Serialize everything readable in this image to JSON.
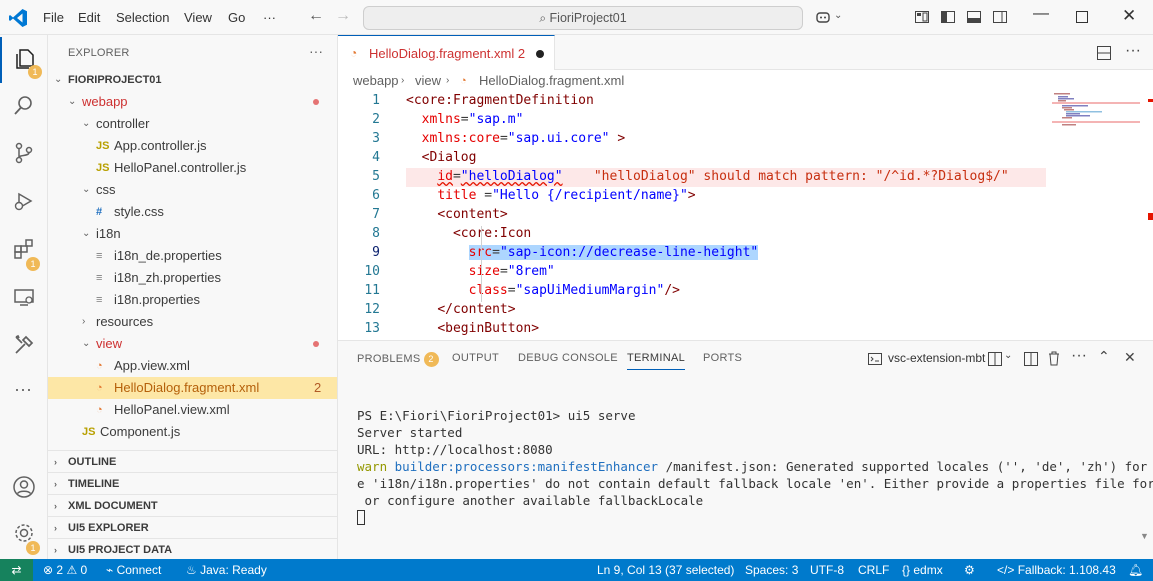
{
  "titlebar": {
    "menu": [
      "File",
      "Edit",
      "Selection",
      "View",
      "Go"
    ],
    "more": "···",
    "search": "FioriProject01"
  },
  "sidebar": {
    "header": "EXPLORER",
    "project": "FIORIPROJECT01",
    "tree": [
      {
        "label": "webapp",
        "kind": "folder-open",
        "depth": 1,
        "status": "dot"
      },
      {
        "label": "controller",
        "kind": "folder-open",
        "depth": 2
      },
      {
        "label": "App.controller.js",
        "kind": "js",
        "depth": 3
      },
      {
        "label": "HelloPanel.controller.js",
        "kind": "js",
        "depth": 3
      },
      {
        "label": "css",
        "kind": "folder-open",
        "depth": 2
      },
      {
        "label": "style.css",
        "kind": "css",
        "depth": 3
      },
      {
        "label": "i18n",
        "kind": "folder-open",
        "depth": 2
      },
      {
        "label": "i18n_de.properties",
        "kind": "props",
        "depth": 3
      },
      {
        "label": "i18n_zh.properties",
        "kind": "props",
        "depth": 3
      },
      {
        "label": "i18n.properties",
        "kind": "props",
        "depth": 3
      },
      {
        "label": "resources",
        "kind": "folder-closed",
        "depth": 2
      },
      {
        "label": "view",
        "kind": "folder-open",
        "depth": 2,
        "status": "dot"
      },
      {
        "label": "App.view.xml",
        "kind": "xml",
        "depth": 3
      },
      {
        "label": "HelloDialog.fragment.xml",
        "kind": "xml",
        "depth": 3,
        "selected": true,
        "count": "2"
      },
      {
        "label": "HelloPanel.view.xml",
        "kind": "xml",
        "depth": 3
      },
      {
        "label": "Component.js",
        "kind": "js",
        "depth": 2
      }
    ],
    "sections": [
      "OUTLINE",
      "TIMELINE",
      "XML DOCUMENT",
      "UI5 EXPLORER",
      "UI5 PROJECT DATA"
    ]
  },
  "editor": {
    "tab_label": "HelloDialog.fragment.xml",
    "tab_count": "2",
    "breadcrumb": [
      "webapp",
      "view",
      "HelloDialog.fragment.xml"
    ],
    "line_numbers": [
      "1",
      "2",
      "3",
      "4",
      "5",
      "6",
      "7",
      "8",
      "9",
      "10",
      "11",
      "12",
      "13"
    ],
    "hint": "\"helloDialog\" should match pattern: \"/^id.*?Dialog$/\""
  },
  "panel": {
    "tabs": [
      "PROBLEMS",
      "OUTPUT",
      "DEBUG CONSOLE",
      "TERMINAL",
      "PORTS"
    ],
    "problems_count": "2",
    "terminal_name": "vsc-extension-mbt",
    "terminal_lines": {
      "prompt": "PS E:\\Fiori\\FioriProject01>",
      "command": "ui5 serve",
      "line2": "Server started",
      "line3": "URL: http://localhost:8080",
      "warn_tag": "warn",
      "warn_src": "builder:processors:manifestEnhancer",
      "warn_msg1": "/manifest.json: Generated supported locales ('', 'de', 'zh') for bundl",
      "warn_msg2": "e 'i18n/i18n.properties' do not contain default fallback locale 'en'. Either provide a properties file for 'en'",
      "warn_msg3": " or configure another available fallbackLocale"
    }
  },
  "statusbar": {
    "problems": "2",
    "warnings": "0",
    "connect": "Connect",
    "java": "Java: Ready",
    "position": "Ln 9, Col 13 (37 selected)",
    "spaces": "Spaces: 3",
    "encoding": "UTF-8",
    "eol": "CRLF",
    "lang": "edmx",
    "fallback": "Fallback: 1.108.43"
  },
  "colors": {
    "accent": "#005fb8",
    "statusbar": "#007acc",
    "remote": "#16825d",
    "error": "#cd3131",
    "selection": "#fde7a6"
  }
}
